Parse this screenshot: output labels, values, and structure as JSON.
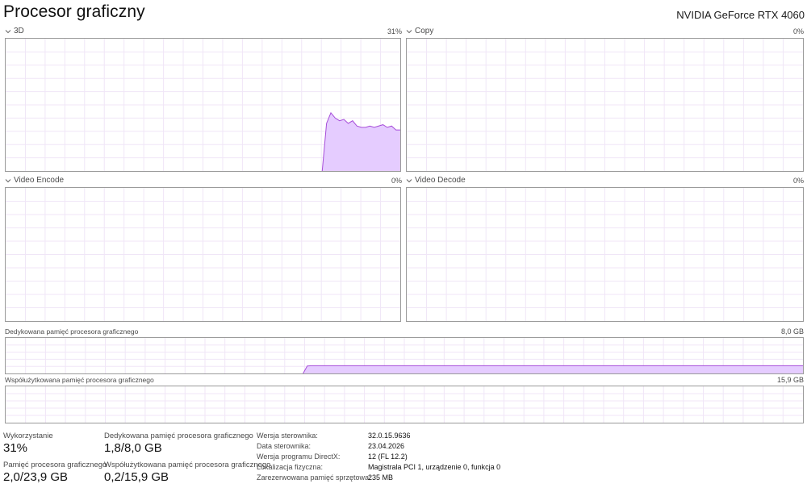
{
  "header": {
    "title": "Procesor graficzny",
    "gpu_name": "NVIDIA GeForce RTX 4060"
  },
  "engines": [
    {
      "label": "3D",
      "percent": "31%"
    },
    {
      "label": "Copy",
      "percent": "0%"
    },
    {
      "label": "Video Encode",
      "percent": "0%"
    },
    {
      "label": "Video Decode",
      "percent": "0%"
    }
  ],
  "memory_graphs": {
    "dedicated": {
      "label": "Dedykowana pamięć procesora graficznego",
      "max": "8,0 GB"
    },
    "shared": {
      "label": "Współużytkowana pamięć procesora graficznego",
      "max": "15,9 GB"
    }
  },
  "stats": {
    "utilization": {
      "label": "Wykorzystanie",
      "value": "31%"
    },
    "dedicated": {
      "label": "Dedykowana pamięć procesora graficznego",
      "value": "1,8/8,0 GB"
    },
    "gpu_memory": {
      "label": "Pamięć procesora graficznego",
      "value": "2,0/23,9 GB"
    },
    "shared": {
      "label": "Współużytkowana pamięć procesora graficznego",
      "value": "0,2/15,9 GB"
    }
  },
  "info": [
    {
      "key": "Wersja sterownika:",
      "value": "32.0.15.9636"
    },
    {
      "key": "Data sterownika:",
      "value": "23.04.2026"
    },
    {
      "key": "Wersja programu DirectX:",
      "value": "12 (FL 12.2)"
    },
    {
      "key": "Lokalizacja fizyczna:",
      "value": "Magistrala PCI 1, urządzenie 0, funkcja 0"
    },
    {
      "key": "Zarezerwowana pamięć sprzętowa:",
      "value": "235 MB"
    }
  ],
  "series": {
    "engine_3d": [
      0,
      0,
      0,
      0,
      0,
      0,
      0,
      0,
      0,
      0,
      0,
      0,
      0,
      0,
      0,
      0,
      0,
      0,
      0,
      0,
      0,
      0,
      0,
      0,
      0,
      0,
      0,
      0,
      0,
      0,
      0,
      0,
      0,
      0,
      0,
      0,
      0,
      0,
      0,
      0,
      0,
      0,
      0,
      0,
      0,
      0,
      0,
      0,
      0,
      0,
      0,
      0,
      0,
      0,
      0,
      0,
      0,
      0,
      0,
      0,
      0,
      0,
      0,
      0,
      0,
      0,
      0,
      0,
      0,
      0,
      0,
      0,
      0,
      0,
      36,
      44,
      40,
      38,
      39,
      36,
      38,
      34,
      33,
      33,
      34,
      33,
      34,
      35,
      33,
      34,
      31,
      31
    ],
    "engine_copy": [],
    "engine_video_encode": [],
    "engine_video_decode": [],
    "dedicated_memory": [
      0,
      0,
      0,
      0,
      0,
      0,
      0,
      0,
      0,
      0,
      0,
      0,
      0,
      0,
      0,
      0,
      0,
      0,
      0,
      0,
      0,
      0,
      0,
      0,
      0,
      0,
      0,
      0,
      0,
      0,
      0,
      0,
      0,
      0,
      0,
      0,
      0,
      0,
      0,
      0,
      0,
      0,
      0,
      0,
      0,
      0,
      0,
      0,
      0,
      0,
      0,
      0,
      0,
      0,
      0,
      0,
      0,
      0,
      0,
      0,
      0,
      0,
      0,
      0,
      0,
      0,
      0,
      0,
      0,
      0,
      0,
      0,
      0,
      21,
      22,
      22,
      22,
      22,
      22,
      22,
      22,
      22,
      22,
      22,
      22,
      22,
      22,
      22,
      22,
      22,
      22,
      22,
      22,
      22,
      22,
      22,
      22,
      22,
      22,
      22,
      22,
      22,
      22,
      22,
      22,
      22,
      22,
      22,
      22,
      22,
      22,
      22,
      22,
      22,
      22,
      22,
      22,
      22,
      22,
      22,
      22,
      22,
      22,
      22,
      22,
      22,
      22,
      22,
      22,
      22,
      22,
      22,
      22,
      22,
      22,
      22,
      22,
      22,
      22,
      22,
      22,
      22,
      22,
      22,
      22,
      22,
      22,
      22,
      22,
      22,
      22,
      22,
      22,
      22,
      22,
      22,
      22,
      22,
      22,
      22,
      22,
      22,
      22,
      22,
      22,
      22,
      22,
      22,
      22,
      22,
      22,
      22,
      22,
      22,
      22,
      22,
      22,
      22,
      22,
      22,
      22,
      22,
      22,
      22,
      22,
      22,
      22,
      22,
      22,
      22,
      22,
      22,
      22,
      22
    ],
    "shared_memory": []
  },
  "colors": {
    "accent": "#a64dd9",
    "fill": "#e5ccff",
    "grid": "#f0e6f7",
    "border": "#9a9a9a"
  }
}
